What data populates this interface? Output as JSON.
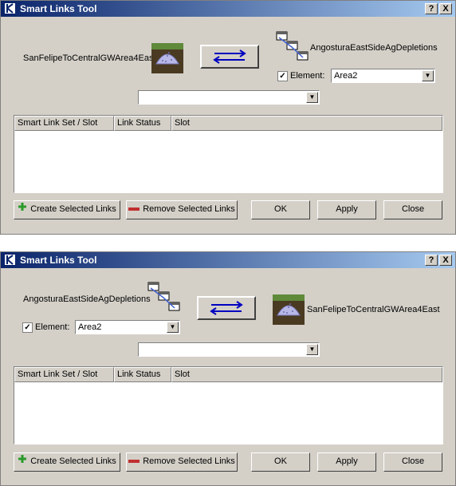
{
  "windows": [
    {
      "title": "Smart Links Tool",
      "help_label": "?",
      "close_label": "X",
      "left_object": {
        "name": "SanFelipeToCentralGWArea4East",
        "icon": "groundwater-storage-icon"
      },
      "right_object": {
        "name": "AngosturaEastSideAgDepletions",
        "icon": "agg-diversion-icon"
      },
      "element": {
        "checked": true,
        "label": "Element:",
        "value": "Area2"
      },
      "slot_filter": {
        "value": ""
      },
      "table": {
        "columns": [
          "Smart Link Set / Slot",
          "Link Status",
          "Slot"
        ],
        "rows": []
      },
      "buttons": {
        "create": "Create Selected Links",
        "remove": "Remove Selected Links",
        "ok": "OK",
        "apply": "Apply",
        "close": "Close"
      }
    },
    {
      "title": "Smart Links Tool",
      "help_label": "?",
      "close_label": "X",
      "left_object": {
        "name": "AngosturaEastSideAgDepletions",
        "icon": "agg-diversion-icon"
      },
      "right_object": {
        "name": "SanFelipeToCentralGWArea4East",
        "icon": "groundwater-storage-icon"
      },
      "element": {
        "checked": true,
        "label": "Element:",
        "value": "Area2"
      },
      "slot_filter": {
        "value": ""
      },
      "table": {
        "columns": [
          "Smart Link Set / Slot",
          "Link Status",
          "Slot"
        ],
        "rows": []
      },
      "buttons": {
        "create": "Create Selected Links",
        "remove": "Remove Selected Links",
        "ok": "OK",
        "apply": "Apply",
        "close": "Close"
      }
    }
  ],
  "colors": {
    "title_start": "#0a246a",
    "title_end": "#a6caf0",
    "window_bg": "#d4d0c8"
  }
}
